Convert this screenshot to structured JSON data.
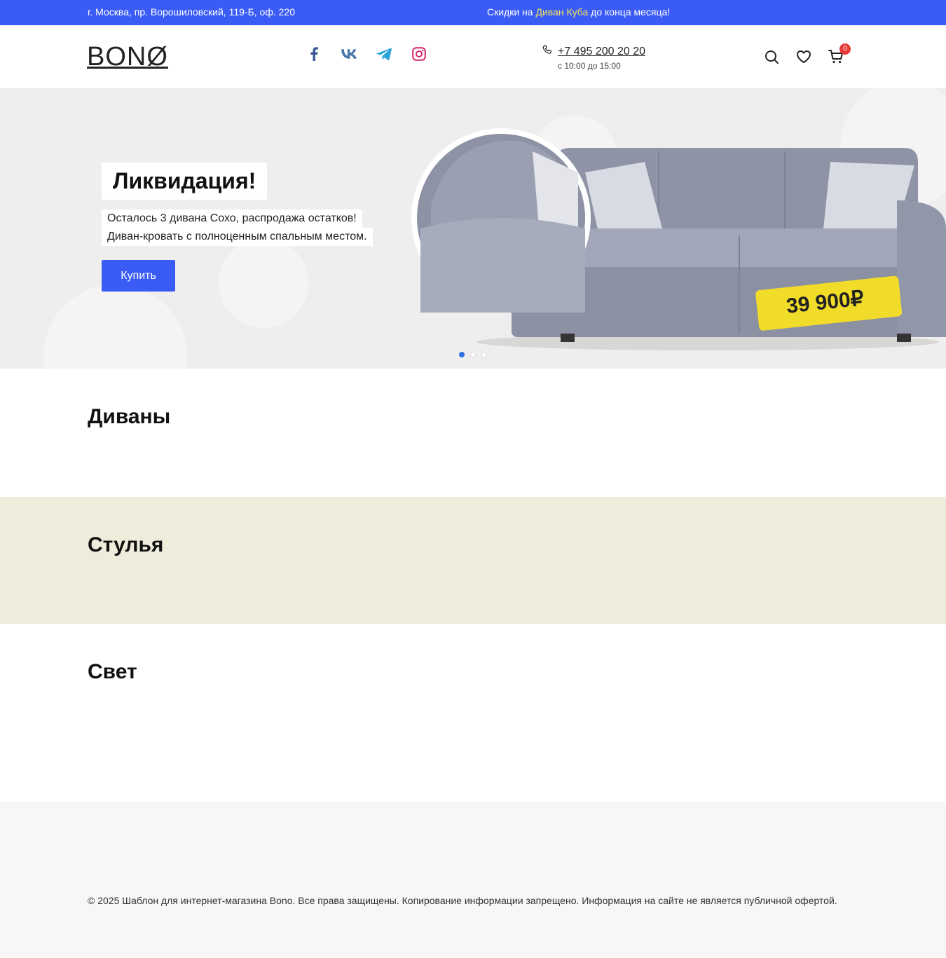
{
  "topbar": {
    "address": "г. Москва, пр. Ворошиловский, 119-Б, оф. 220",
    "promo_before": "Скидки на ",
    "promo_link": "Диван Куба",
    "promo_after": " до конца месяца!"
  },
  "header": {
    "logo": "BONØ",
    "socials": [
      "facebook-icon",
      "vk-icon",
      "telegram-icon",
      "instagram-icon"
    ],
    "phone": "+7 495 200 20 20",
    "hours": "с 10:00 до 15:00",
    "cart_count": "0"
  },
  "hero": {
    "title": "Ликвидация!",
    "line1": "Осталось 3 дивана Сохо, распродажа остатков!",
    "line2": "Диван-кровать с полноценным спальным местом.",
    "button": "Купить",
    "price": "39 900₽",
    "slides": 3,
    "active_slide": 1
  },
  "sections": {
    "sofas": "Диваны",
    "chairs": "Стулья",
    "light": "Свет"
  },
  "footer": {
    "copyright": "© 2025 Шаблон для интернет-магазина Bono. Все права защищены. Копирование информации запрещено. Информация на сайте не является публичной офертой."
  },
  "colors": {
    "accent": "#3a5cf5",
    "promo_highlight": "#f3e35a",
    "chairs_bg": "#eeeddb",
    "footer_bg": "#f7f7f7",
    "price_tag": "#f2dc2a"
  }
}
